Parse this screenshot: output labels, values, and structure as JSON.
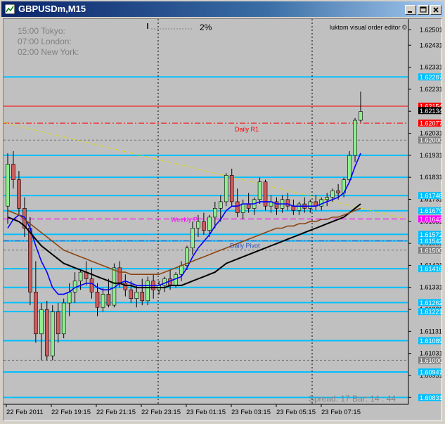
{
  "window": {
    "title": "GBPUSDm,M15",
    "buttons": [
      "minimize",
      "maximize",
      "close"
    ]
  },
  "chart": {
    "session_times": [
      {
        "time": "15:00",
        "city": "Tokyo:"
      },
      {
        "time": "07:00",
        "city": "London:"
      },
      {
        "time": "02:00",
        "city": "New York:"
      }
    ],
    "percent_label": "2%",
    "editor_label": "luktom visual order editor",
    "spread_bar": "Spread: 17   Bar: 14 : 44",
    "daily_r1_label": "Daily R1",
    "weekly_label": "Weekly P",
    "daily_pivot_label": "Daily Pivot",
    "chart_data": {
      "type": "candlestick",
      "symbol": "GBPUSDm",
      "timeframe": "M15",
      "ylim": [
        1.608,
        1.6255
      ],
      "x_tick_labels": [
        "22 Feb 2011",
        "22 Feb 19:15",
        "22 Feb 21:15",
        "22 Feb 23:15",
        "23 Feb 01:15",
        "23 Feb 03:15",
        "23 Feb 05:15",
        "23 Feb 07:15"
      ],
      "price_scale_labels": [
        "1.62501",
        "1.62431",
        "1.62331",
        "1.62231",
        "1.62131",
        "1.62031",
        "1.61931",
        "1.61831",
        "1.61731",
        "1.61631",
        "1.61531",
        "1.61431",
        "1.61331",
        "1.61231",
        "1.61131",
        "1.61031",
        "1.60931",
        "1.60831"
      ],
      "highlighted_levels": [
        {
          "label": "1.62287",
          "value": 1.62287,
          "color": "#00bfff"
        },
        {
          "label": "1.62154",
          "value": 1.62154,
          "color": "#ff0000"
        },
        {
          "label": "1.62134",
          "value": 1.62134,
          "color": "#000000"
        },
        {
          "label": "1.62077",
          "value": 1.62077,
          "color": "#ff0000"
        },
        {
          "label": "1.62000",
          "value": 1.62,
          "color": "#808080"
        },
        {
          "label": "1.61748",
          "value": 1.61748,
          "color": "#00bfff"
        },
        {
          "label": "1.61679",
          "value": 1.61679,
          "color": "#00bfff"
        },
        {
          "label": "1.61642",
          "value": 1.61642,
          "color": "#ff00ff"
        },
        {
          "label": "1.61572",
          "value": 1.61572,
          "color": "#00bfff"
        },
        {
          "label": "1.61542",
          "value": 1.61542,
          "color": "#00bfff"
        },
        {
          "label": "1.61500",
          "value": 1.615,
          "color": "#808080"
        },
        {
          "label": "1.61416",
          "value": 1.61416,
          "color": "#00bfff"
        },
        {
          "label": "1.61262",
          "value": 1.61262,
          "color": "#00bfff"
        },
        {
          "label": "1.61221",
          "value": 1.61221,
          "color": "#00bfff"
        },
        {
          "label": "1.61089",
          "value": 1.61089,
          "color": "#00bfff"
        },
        {
          "label": "1.61000",
          "value": 1.61,
          "color": "#808080"
        },
        {
          "label": "1.60947",
          "value": 1.60947,
          "color": "#00bfff"
        },
        {
          "label": "1.60831",
          "value": 1.60831,
          "color": "#00bfff"
        }
      ],
      "cyan_level_values": [
        1.62287,
        1.61931,
        1.61831,
        1.61748,
        1.61679,
        1.61572,
        1.61542,
        1.61416,
        1.61331,
        1.61262,
        1.61221,
        1.61089,
        1.60947,
        1.60831
      ],
      "candles_ohlc": [
        [
          1.617,
          1.6194,
          1.6162,
          1.6189
        ],
        [
          1.6189,
          1.6195,
          1.6178,
          1.6182
        ],
        [
          1.6182,
          1.6186,
          1.6166,
          1.6169
        ],
        [
          1.6169,
          1.6174,
          1.6156,
          1.616
        ],
        [
          1.616,
          1.6165,
          1.6125,
          1.6131
        ],
        [
          1.6131,
          1.6145,
          1.6108,
          1.6112
        ],
        [
          1.6112,
          1.6126,
          1.61,
          1.6123
        ],
        [
          1.6123,
          1.6127,
          1.61,
          1.6102
        ],
        [
          1.6102,
          1.6125,
          1.61,
          1.6122
        ],
        [
          1.6122,
          1.6126,
          1.6108,
          1.6112
        ],
        [
          1.6112,
          1.6128,
          1.611,
          1.6126
        ],
        [
          1.6126,
          1.6135,
          1.612,
          1.6131
        ],
        [
          1.6131,
          1.614,
          1.6126,
          1.6136
        ],
        [
          1.6136,
          1.6141,
          1.6132,
          1.614
        ],
        [
          1.614,
          1.6145,
          1.6134,
          1.6137
        ],
        [
          1.6137,
          1.6142,
          1.6128,
          1.6131
        ],
        [
          1.6131,
          1.6135,
          1.612,
          1.6124
        ],
        [
          1.6124,
          1.6133,
          1.6122,
          1.613
        ],
        [
          1.613,
          1.6137,
          1.6124,
          1.6125
        ],
        [
          1.6125,
          1.6144,
          1.6124,
          1.6142
        ],
        [
          1.6142,
          1.6145,
          1.6133,
          1.6135
        ],
        [
          1.6135,
          1.6139,
          1.6129,
          1.6132
        ],
        [
          1.6132,
          1.6136,
          1.6126,
          1.6128
        ],
        [
          1.6128,
          1.6134,
          1.6124,
          1.6131
        ],
        [
          1.6131,
          1.6137,
          1.6125,
          1.6127
        ],
        [
          1.6127,
          1.6138,
          1.6125,
          1.6136
        ],
        [
          1.6136,
          1.6139,
          1.6128,
          1.6132
        ],
        [
          1.6132,
          1.6136,
          1.613,
          1.6134
        ],
        [
          1.6134,
          1.6138,
          1.6131,
          1.6137
        ],
        [
          1.6137,
          1.6141,
          1.6132,
          1.6134
        ],
        [
          1.6134,
          1.614,
          1.6133,
          1.6139
        ],
        [
          1.6139,
          1.6145,
          1.6136,
          1.6143
        ],
        [
          1.6143,
          1.6152,
          1.6141,
          1.6151
        ],
        [
          1.6151,
          1.6163,
          1.6148,
          1.616
        ],
        [
          1.616,
          1.6166,
          1.6156,
          1.6163
        ],
        [
          1.6163,
          1.6167,
          1.6157,
          1.6159
        ],
        [
          1.6159,
          1.6166,
          1.6156,
          1.6165
        ],
        [
          1.6165,
          1.6172,
          1.616,
          1.6169
        ],
        [
          1.6169,
          1.6175,
          1.6163,
          1.6172
        ],
        [
          1.6172,
          1.6185,
          1.617,
          1.6184
        ],
        [
          1.6184,
          1.6187,
          1.617,
          1.6172
        ],
        [
          1.6172,
          1.6178,
          1.6165,
          1.6167
        ],
        [
          1.6167,
          1.6173,
          1.6164,
          1.6171
        ],
        [
          1.6171,
          1.6176,
          1.6167,
          1.6169
        ],
        [
          1.6169,
          1.6174,
          1.6166,
          1.6173
        ],
        [
          1.6173,
          1.6183,
          1.6171,
          1.6181
        ],
        [
          1.6181,
          1.6182,
          1.6168,
          1.617
        ],
        [
          1.617,
          1.6175,
          1.6167,
          1.6172
        ],
        [
          1.6172,
          1.6174,
          1.6166,
          1.6169
        ],
        [
          1.6169,
          1.6175,
          1.6167,
          1.6173
        ],
        [
          1.6173,
          1.6176,
          1.6168,
          1.617
        ],
        [
          1.617,
          1.6173,
          1.6166,
          1.6168
        ],
        [
          1.6168,
          1.6172,
          1.6166,
          1.6171
        ],
        [
          1.6171,
          1.6174,
          1.6167,
          1.6169
        ],
        [
          1.6169,
          1.6173,
          1.6167,
          1.6172
        ],
        [
          1.6172,
          1.6175,
          1.6168,
          1.617
        ],
        [
          1.617,
          1.6174,
          1.6168,
          1.6173
        ],
        [
          1.6173,
          1.6176,
          1.617,
          1.6174
        ],
        [
          1.6174,
          1.6178,
          1.6172,
          1.6177
        ],
        [
          1.6177,
          1.618,
          1.6173,
          1.6176
        ],
        [
          1.6176,
          1.6183,
          1.6174,
          1.6182
        ],
        [
          1.6182,
          1.6195,
          1.6181,
          1.6193
        ],
        [
          1.6193,
          1.621,
          1.619,
          1.6209
        ],
        [
          1.6209,
          1.6222,
          1.6208,
          1.6213
        ]
      ],
      "moving_averages": [
        {
          "color": "#0000ff",
          "values": [
            1.616,
            1.6164,
            1.6166,
            1.6165,
            1.616,
            1.6152,
            1.6145,
            1.614,
            1.6133,
            1.613,
            1.613,
            1.6131,
            1.6133,
            1.6134,
            1.6135,
            1.6135,
            1.6133,
            1.6132,
            1.6132,
            1.6133,
            1.6135,
            1.6136,
            1.6135,
            1.6134,
            1.6134,
            1.6134,
            1.6134,
            1.6134,
            1.6135,
            1.6136,
            1.6137,
            1.6138,
            1.6142,
            1.6147,
            1.6151,
            1.6154,
            1.6157,
            1.6161,
            1.6164,
            1.6168,
            1.617,
            1.617,
            1.6171,
            1.6171,
            1.6171,
            1.6172,
            1.6172,
            1.6172,
            1.6171,
            1.6171,
            1.6171,
            1.617,
            1.617,
            1.617,
            1.617,
            1.617,
            1.6171,
            1.6172,
            1.6173,
            1.6174,
            1.6176,
            1.6181,
            1.6188,
            1.6194
          ]
        },
        {
          "color": "#000000",
          "values": [
            1.6165,
            1.6164,
            1.6163,
            1.6161,
            1.6158,
            1.6155,
            1.6152,
            1.615,
            1.6148,
            1.6146,
            1.6144,
            1.6143,
            1.6142,
            1.6141,
            1.614,
            1.6139,
            1.6138,
            1.6137,
            1.6136,
            1.6135,
            1.6135,
            1.6134,
            1.6134,
            1.6133,
            1.6133,
            1.6133,
            1.6133,
            1.6133,
            1.6133,
            1.6134,
            1.6134,
            1.6134,
            1.6135,
            1.6136,
            1.6137,
            1.6138,
            1.6139,
            1.614,
            1.6142,
            1.6144,
            1.6145,
            1.6146,
            1.6147,
            1.6148,
            1.6149,
            1.615,
            1.6151,
            1.6152,
            1.6153,
            1.6154,
            1.6155,
            1.6156,
            1.6157,
            1.6158,
            1.6159,
            1.616,
            1.6161,
            1.6162,
            1.6163,
            1.6164,
            1.6165,
            1.6167,
            1.6169,
            1.6171
          ]
        },
        {
          "color": "#8b4513",
          "values": [
            1.6168,
            1.6167,
            1.6166,
            1.6164,
            1.6162,
            1.616,
            1.6158,
            1.6156,
            1.6154,
            1.6152,
            1.615,
            1.6149,
            1.6148,
            1.6147,
            1.6146,
            1.6145,
            1.6144,
            1.6143,
            1.6142,
            1.6141,
            1.614,
            1.614,
            1.6139,
            1.6139,
            1.6139,
            1.6139,
            1.6139,
            1.6139,
            1.614,
            1.6141,
            1.6142,
            1.6143,
            1.6144,
            1.6145,
            1.6146,
            1.6147,
            1.6148,
            1.6149,
            1.615,
            1.6151,
            1.6152,
            1.6153,
            1.6154,
            1.6155,
            1.6156,
            1.6157,
            1.6158,
            1.6159,
            1.616,
            1.616,
            1.6161,
            1.6161,
            1.6162,
            1.6162,
            1.6163,
            1.6163,
            1.6164,
            1.6164,
            1.6165,
            1.6165,
            1.6166,
            1.6167,
            1.6168,
            1.6169
          ]
        }
      ]
    }
  },
  "colors": {
    "chart_bg": "#c0c0c0",
    "bull": "#90ee90",
    "bear": "#cd5c5c",
    "cyan_line": "#00bfff",
    "title_bar": "#0a246a"
  }
}
